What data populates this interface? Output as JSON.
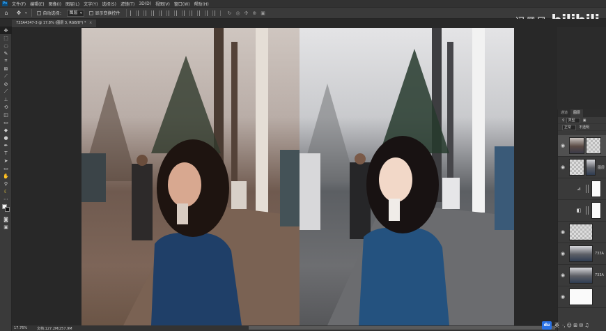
{
  "menu": [
    "文件(F)",
    "编辑(E)",
    "图像(I)",
    "图层(L)",
    "文字(Y)",
    "选择(S)",
    "滤镜(T)",
    "3D(D)",
    "视图(V)",
    "窗口(W)",
    "帮助(H)"
  ],
  "options": {
    "auto_select_label": "自动选择：",
    "auto_select_value": "图层",
    "show_transform_label": "显示变换控件"
  },
  "watermark": {
    "author": "冯墨风",
    "brand": "bilibili"
  },
  "document_tab": {
    "title": "733A4347-3 @ 17.8% (图层 3, RGB/8*) *",
    "close": "×"
  },
  "status": {
    "zoom": "17.76%",
    "doc_info": "文档:127.2M/257.9M"
  },
  "layers_panel": {
    "tabs": [
      "通道",
      "图层"
    ],
    "filter_label": "类型",
    "blend_mode": "正常",
    "opacity_label": "不透明",
    "layers": [
      {
        "name": "",
        "visible": true,
        "selected": true
      },
      {
        "name": "图层",
        "visible": true,
        "selected": false
      },
      {
        "name": "",
        "visible": false,
        "selected": false
      },
      {
        "name": "",
        "visible": false,
        "selected": false
      },
      {
        "name": "",
        "visible": true,
        "selected": false
      },
      {
        "name": "733A",
        "visible": true,
        "selected": false
      },
      {
        "name": "733A",
        "visible": true,
        "selected": false
      },
      {
        "name": "",
        "visible": true,
        "selected": false
      }
    ]
  },
  "tray": {
    "badge": "du",
    "ime": "英",
    "extra": "·, ☺ ⊞ ✉ ♫"
  },
  "colors": {
    "accent": "#31a8ff",
    "panel": "#3a3a3a",
    "canvas_bg": "#282828"
  }
}
